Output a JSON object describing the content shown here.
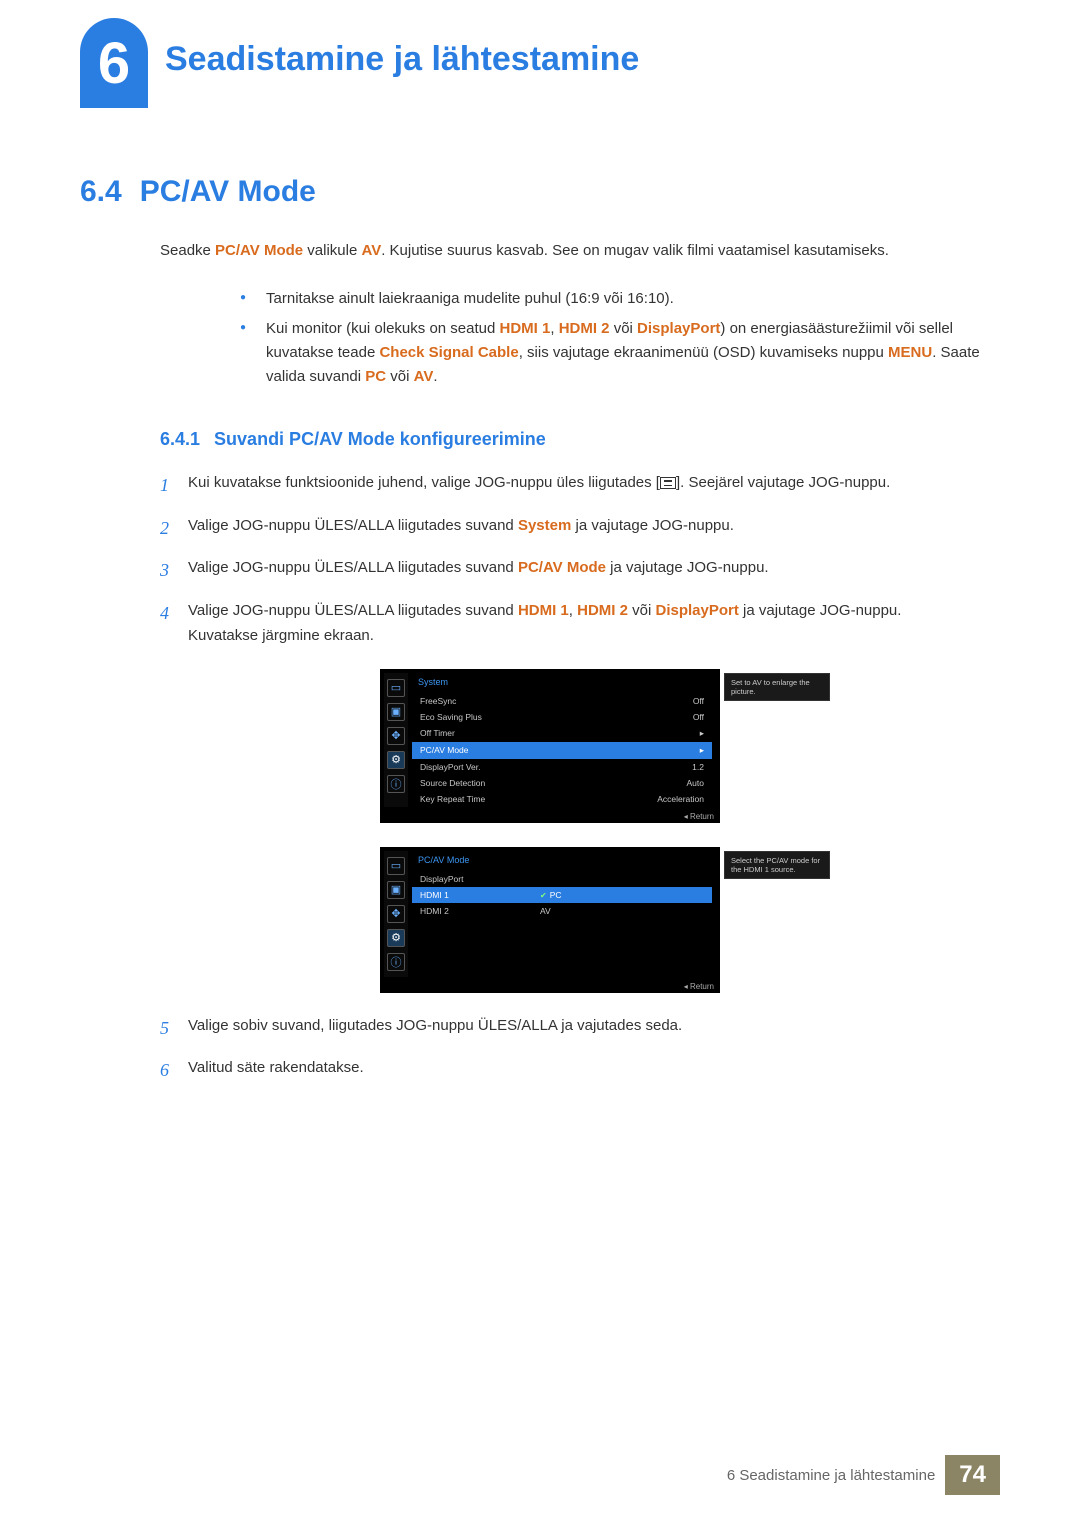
{
  "header": {
    "chapter_number": "6",
    "chapter_title": "Seadistamine ja lähtestamine"
  },
  "section": {
    "number": "6.4",
    "title": "PC/AV Mode"
  },
  "intro": {
    "prefix": "Seadke ",
    "pcav": "PC/AV Mode",
    "mid": " valikule ",
    "av": "AV",
    "suffix": ". Kujutise suurus kasvab. See on mugav valik filmi vaatamisel kasutamiseks."
  },
  "bullets": [
    {
      "text": "Tarnitakse ainult laiekraaniga mudelite puhul (16:9 või 16:10)."
    },
    {
      "pre": "Kui monitor (kui olekuks on seatud ",
      "h1": "HDMI 1",
      "c1": ", ",
      "h2": "HDMI 2",
      "c2": " või ",
      "h3": "DisplayPort",
      "mid": ") on energiasäästurežiimil või sellel kuvatakse teade ",
      "csc": "Check Signal Cable",
      "mid2": ", siis vajutage ekraanimenüü (OSD) kuvamiseks nuppu ",
      "menu": "MENU",
      "mid3": ". Saate valida suvandi ",
      "pc": "PC",
      "c3": " või ",
      "av": "AV",
      "end": "."
    }
  ],
  "subsection": {
    "number": "6.4.1",
    "title": "Suvandi PC/AV Mode konfigureerimine"
  },
  "steps": {
    "s1a": "Kui kuvatakse funktsioonide juhend, valige JOG-nuppu üles liigutades [",
    "s1b": "]. Seejärel vajutage JOG-nuppu.",
    "s2a": "Valige JOG-nuppu ÜLES/ALLA liigutades suvand ",
    "s2hl": "System",
    "s2b": " ja vajutage JOG-nuppu.",
    "s3a": "Valige JOG-nuppu ÜLES/ALLA liigutades suvand ",
    "s3hl": "PC/AV Mode",
    "s3b": " ja vajutage JOG-nuppu.",
    "s4a": "Valige JOG-nuppu ÜLES/ALLA liigutades suvand ",
    "s4h1": "HDMI 1",
    "s4c1": ", ",
    "s4h2": "HDMI 2",
    "s4c2": " või ",
    "s4h3": "DisplayPort",
    "s4b": " ja vajutage JOG-nuppu.",
    "s4c": "Kuvatakse järgmine ekraan.",
    "s5": "Valige sobiv suvand, liigutades JOG-nuppu ÜLES/ALLA ja vajutades seda.",
    "s6": "Valitud säte rakendatakse."
  },
  "step_nums": {
    "n1": "1",
    "n2": "2",
    "n3": "3",
    "n4": "4",
    "n5": "5",
    "n6": "6"
  },
  "osd1": {
    "title": "System",
    "tooltip": "Set to AV to enlarge the picture.",
    "rows": [
      {
        "label": "FreeSync",
        "value": "Off"
      },
      {
        "label": "Eco Saving Plus",
        "value": "Off"
      },
      {
        "label": "Off Timer",
        "value": "▸"
      },
      {
        "label": "PC/AV Mode",
        "value": "▸",
        "selected": true
      },
      {
        "label": "DisplayPort Ver.",
        "value": "1.2"
      },
      {
        "label": "Source Detection",
        "value": "Auto"
      },
      {
        "label": "Key Repeat Time",
        "value": "Acceleration"
      }
    ],
    "return": "Return"
  },
  "osd2": {
    "title": "PC/AV Mode",
    "tooltip": "Select the PC/AV mode for the HDMI 1 source.",
    "items": [
      {
        "label": "DisplayPort"
      },
      {
        "label": "HDMI 1",
        "selected": true
      },
      {
        "label": "HDMI 2"
      }
    ],
    "options": [
      {
        "label": "PC",
        "selected": true,
        "checked": true
      },
      {
        "label": "AV"
      }
    ],
    "return": "Return"
  },
  "footer": {
    "text": "6 Seadistamine ja lähtestamine",
    "page": "74"
  }
}
